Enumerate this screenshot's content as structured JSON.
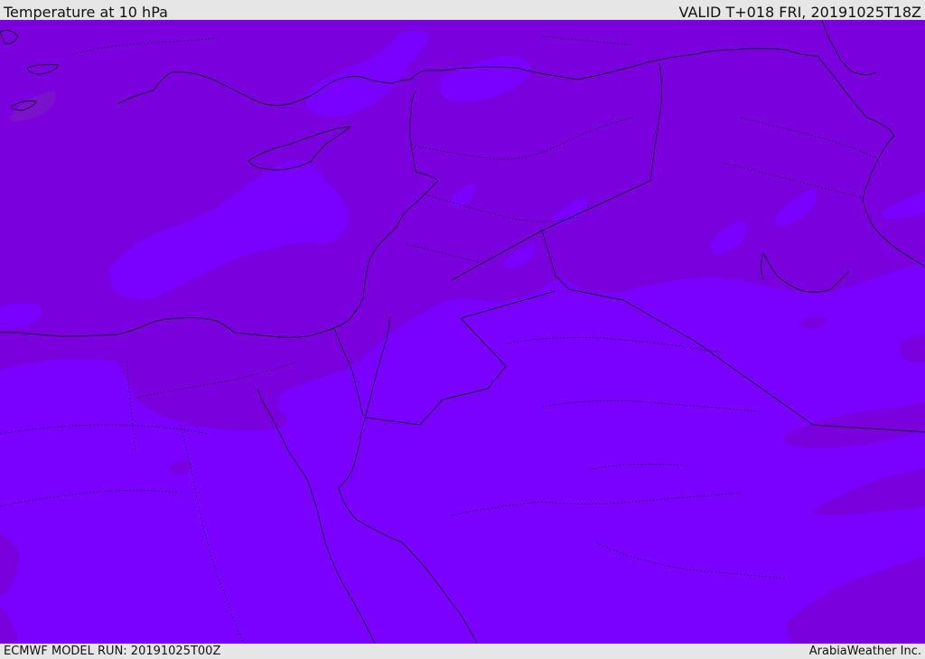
{
  "header": {
    "title": "Temperature at 10 hPa",
    "valid": "VALID T+018 FRI, 20191025T18Z"
  },
  "footer": {
    "model_run": "ECMWF MODEL RUN: 20191025T00Z",
    "provider": "ArabiaWeather Inc."
  },
  "map": {
    "parameter": "Temperature",
    "level": "10 hPa",
    "colors": {
      "warm_band": "#7a00dd",
      "cool_band": "#7a00ff",
      "coastline": "#1a0033",
      "border": "#2a0044"
    }
  }
}
